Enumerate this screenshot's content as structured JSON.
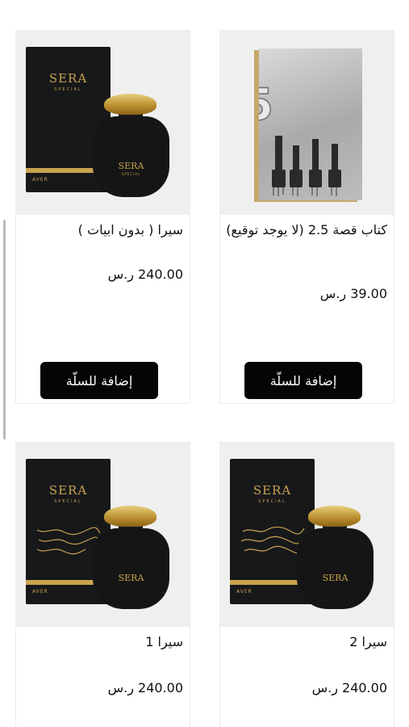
{
  "products": [
    {
      "title": "كتاب قصة 2.5 (لا يوجد توقيع)",
      "price": "39.00 ر.س",
      "add_label": "إضافة للسلّة",
      "book_number": "2.5"
    },
    {
      "title": "سيرا ( بدون ابيات )",
      "price": "240.00 ر.س",
      "add_label": "إضافة للسلّة",
      "brand": "SERA",
      "brand_sub": "SPECIAL",
      "box_footer": "AVER"
    },
    {
      "title": "سيرا 2",
      "price": "240.00 ر.س",
      "brand": "SERA",
      "brand_sub": "SPECIAL",
      "box_footer": "AVER"
    },
    {
      "title": "سيرا 1",
      "price": "240.00 ر.س",
      "brand": "SERA",
      "brand_sub": "SPECIAL",
      "box_footer": "AVER"
    }
  ],
  "colors": {
    "button_bg": "#050505",
    "gold": "#c9a34f",
    "box_black": "#17181a"
  }
}
